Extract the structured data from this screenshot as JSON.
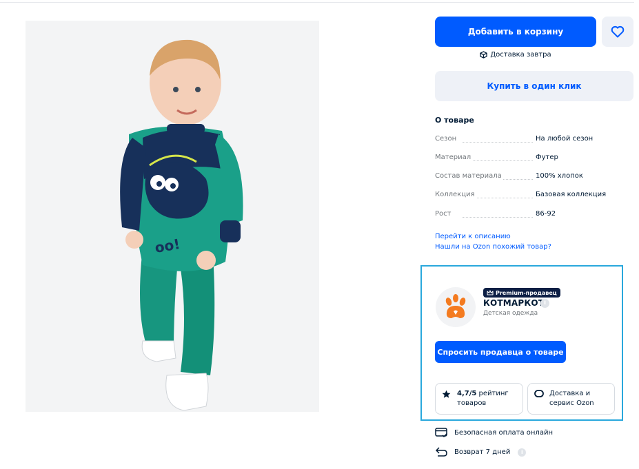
{
  "product": {
    "image_alt": "Малыш в зелёном комбинезоне с монстриком"
  },
  "buy": {
    "add_to_cart": "Добавить в корзину",
    "favorite_icon": "heart-icon",
    "delivery_text": "Доставка завтра",
    "one_click": "Купить в один клик"
  },
  "about": {
    "title": "О товаре",
    "specs": [
      {
        "label": "Сезон",
        "value": "На любой сезон"
      },
      {
        "label": "Материал",
        "value": "Футер"
      },
      {
        "label": "Состав материала",
        "value": "100% хлопок"
      },
      {
        "label": "Коллекция",
        "value": "Базовая коллекция"
      },
      {
        "label": "Рост",
        "value": "86-92"
      }
    ],
    "link_description": "Перейти к описанию",
    "link_similar": "Нашли на Ozon похожий товар?"
  },
  "seller": {
    "badge": "Premium-продавец",
    "name": "КОТМАРКОТ",
    "category": "Детская одежда",
    "ask_button": "Спросить продавца о товаре",
    "rating_value": "4,7/5",
    "rating_text": " рейтинг товаров",
    "delivery_service": "Доставка и сервис Ozon"
  },
  "guarantees": {
    "payment": "Безопасная оплата онлайн",
    "return": "Возврат 7 дней"
  },
  "colors": {
    "accent": "#005bff",
    "card_border": "#29a8dc",
    "badge_bg": "#0c1e44",
    "logo_orange": "#f47b20"
  }
}
